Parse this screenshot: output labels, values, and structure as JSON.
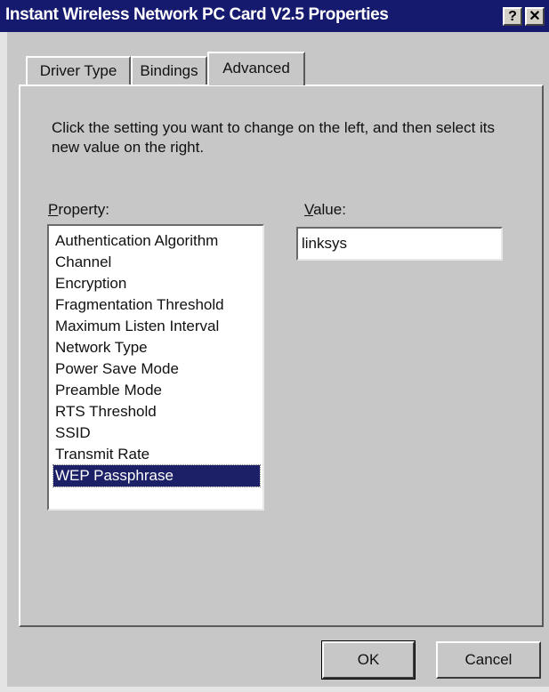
{
  "window": {
    "title": "Instant Wireless Network PC Card V2.5 Properties",
    "help_label": "?",
    "close_label": "✕"
  },
  "tabs": [
    {
      "label": "Driver Type",
      "selected": false
    },
    {
      "label": "Bindings",
      "selected": false
    },
    {
      "label": "Advanced",
      "selected": true
    }
  ],
  "instruction": "Click the setting you want to change on the left, and then select its new value on the right.",
  "property": {
    "label_mnemonic": "P",
    "label_rest": "roperty:",
    "items": [
      "Authentication Algorithm",
      "Channel",
      "Encryption",
      "Fragmentation Threshold",
      "Maximum Listen Interval",
      "Network Type",
      "Power Save Mode",
      "Preamble Mode",
      "RTS Threshold",
      "SSID",
      "Transmit Rate",
      "WEP Passphrase"
    ],
    "selected": "WEP Passphrase"
  },
  "value": {
    "label_mnemonic": "V",
    "label_rest": "alue:",
    "current": "linksys"
  },
  "buttons": {
    "ok": "OK",
    "cancel": "Cancel"
  },
  "colors": {
    "titlebar": "#151a6e",
    "dialog_face": "#c7c7c7",
    "selection": "#1c2066"
  }
}
